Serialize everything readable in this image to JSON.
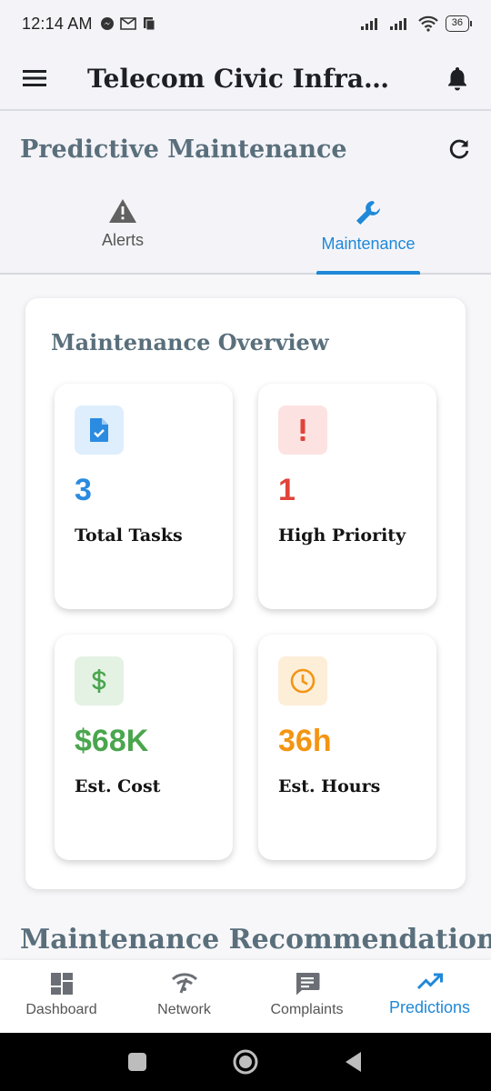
{
  "status_bar": {
    "time": "12:14 AM",
    "battery": "36"
  },
  "app_bar": {
    "title": "Telecom Civic Infrastr...",
    "menu_icon": "menu-icon",
    "notification_icon": "bell-icon"
  },
  "page": {
    "heading": "Predictive Maintenance",
    "refresh_icon": "refresh-icon"
  },
  "tabs": [
    {
      "label": "Alerts",
      "icon": "warning-icon",
      "active": false
    },
    {
      "label": "Maintenance",
      "icon": "wrench-icon",
      "active": true
    }
  ],
  "overview": {
    "title": "Maintenance Overview",
    "stats": [
      {
        "value": "3",
        "label": "Total Tasks",
        "icon": "task-file-icon",
        "color": "#2a8be0",
        "bg": "#deeefc"
      },
      {
        "value": "1",
        "label": "High Priority",
        "icon": "priority-high-icon",
        "color": "#e0443a",
        "bg": "#fde2e2"
      },
      {
        "value": "$68K",
        "label": "Est. Cost",
        "icon": "dollar-icon",
        "color": "#4aa64e",
        "bg": "#e4f2e4"
      },
      {
        "value": "36h",
        "label": "Est. Hours",
        "icon": "clock-icon",
        "color": "#f39513",
        "bg": "#fdeed8"
      }
    ]
  },
  "recommendations": {
    "title": "Maintenance Recommendations"
  },
  "bottom_nav": [
    {
      "label": "Dashboard",
      "icon": "dashboard-icon",
      "active": false
    },
    {
      "label": "Network",
      "icon": "network-icon",
      "active": false
    },
    {
      "label": "Complaints",
      "icon": "chat-icon",
      "active": false
    },
    {
      "label": "Predictions",
      "icon": "trending-up-icon",
      "active": true
    }
  ],
  "colors": {
    "accent": "#1f88d8",
    "heading": "#5a6f7c"
  }
}
